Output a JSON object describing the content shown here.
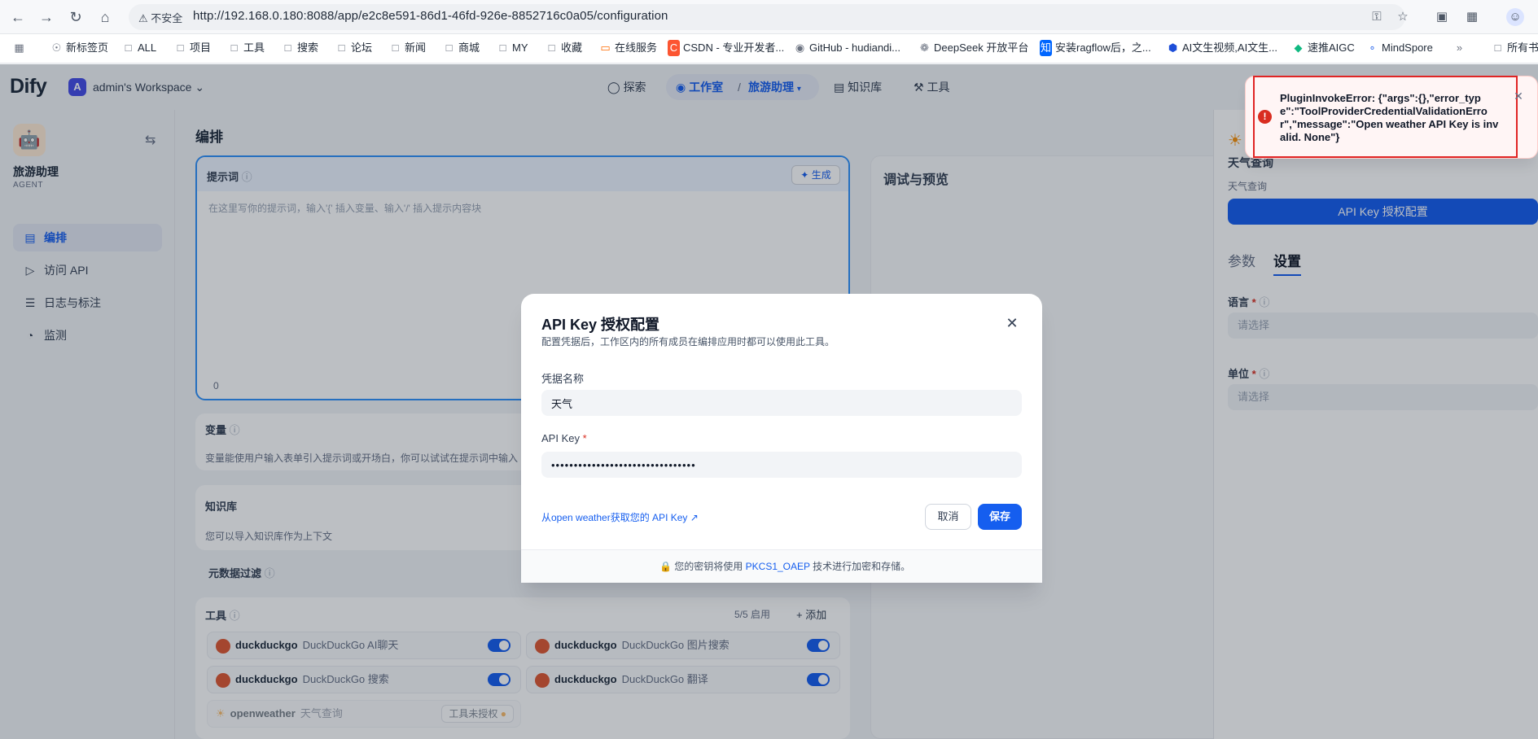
{
  "browser": {
    "insecure_label": "不安全",
    "url": "http://192.168.0.180:8088/app/e2c8e591-86d1-46fd-926e-8852716c0a05/configuration",
    "bookmarks": [
      "新标签页",
      "ALL",
      "项目",
      "工具",
      "搜索",
      "论坛",
      "新闻",
      "商城",
      "MY",
      "收藏",
      "在线服务",
      "CSDN - 专业开发者...",
      "GitHub - hudiandi...",
      "DeepSeek 开放平台",
      "安装ragflow后，之...",
      "AI文生视频,AI文生...",
      "速推AIGC",
      "MindSpore",
      "所有书"
    ]
  },
  "header": {
    "logo": "Dify",
    "workspace_initial": "A",
    "workspace_name": "admin's Workspace",
    "nav": {
      "explore": "探索",
      "studio": "工作室",
      "current_app": "旅游助理",
      "knowledge": "知识库",
      "tools": "工具"
    }
  },
  "sidebar": {
    "app_name": "旅游助理",
    "app_type": "AGENT",
    "items": [
      "编排",
      "访问 API",
      "日志与标注",
      "监测"
    ]
  },
  "editor": {
    "title": "编排",
    "prompt_label": "提示词",
    "generate_label": "生成",
    "prompt_placeholder": "在这里写你的提示词，输入'{' 插入变量、输入'/' 插入提示内容块",
    "char_count": "0",
    "variables_label": "变量",
    "variables_hint": "变量能使用户输入表单引入提示词或开场白，你可以试试在提示词中输入",
    "knowledge_label": "知识库",
    "knowledge_hint": "您可以导入知识库作为上下文",
    "metadata_label": "元数据过滤",
    "tools_label": "工具",
    "tools_enabled": "5/5 启用",
    "tools_add": "添加",
    "tools": [
      {
        "name": "duckduckgo",
        "desc": "DuckDuckGo AI聊天"
      },
      {
        "name": "duckduckgo",
        "desc": "DuckDuckGo 图片搜索"
      },
      {
        "name": "duckduckgo",
        "desc": "DuckDuckGo 搜索"
      },
      {
        "name": "duckduckgo",
        "desc": "DuckDuckGo 翻译"
      }
    ],
    "openweather_tool": {
      "name": "openweather",
      "desc": "天气查询",
      "badge": "工具未授权"
    }
  },
  "preview": {
    "title": "调试与预览"
  },
  "right_panel": {
    "tool_title": "天气查询",
    "tool_desc": "天气查询",
    "api_key_button": "API Key 授权配置",
    "tab_params": "参数",
    "tab_settings": "设置",
    "language_label": "语言",
    "unit_label": "单位",
    "select_placeholder": "请选择"
  },
  "modal": {
    "title": "API Key 授权配置",
    "subtitle": "配置凭据后，工作区内的所有成员在编排应用时都可以使用此工具。",
    "credential_label": "凭据名称",
    "credential_value": "天气",
    "api_key_label": "API Key",
    "api_key_value": "********************************",
    "get_key_link": "从open weather获取您的 API Key",
    "cancel": "取消",
    "save": "保存",
    "footer_prefix": "您的密钥将使用",
    "footer_link": "PKCS1_OAEP",
    "footer_suffix": "技术进行加密和存储。"
  },
  "toast": {
    "message": "PluginInvokeError: {\"args\":{},\"error_type\":\"ToolProviderCredentialValidationError\",\"message\":\"Open weather API Key is invalid. None\"}"
  },
  "colors": {
    "accent": "#155eef",
    "error": "#d92d20"
  }
}
